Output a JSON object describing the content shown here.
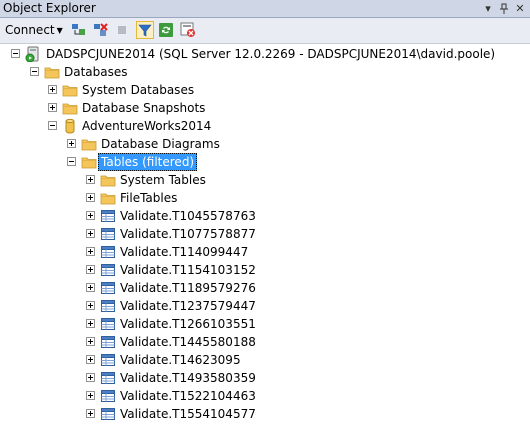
{
  "panel": {
    "title": "Object Explorer"
  },
  "toolbar": {
    "connect_label": "Connect"
  },
  "tree": {
    "server": {
      "label": "DADSPCJUNE2014 (SQL Server 12.0.2269 - DADSPCJUNE2014\\david.poole)"
    },
    "databases": {
      "label": "Databases"
    },
    "system_databases": {
      "label": "System Databases"
    },
    "database_snapshots": {
      "label": "Database Snapshots"
    },
    "adventureworks": {
      "label": "AdventureWorks2014"
    },
    "database_diagrams": {
      "label": "Database Diagrams"
    },
    "tables": {
      "label": "Tables (filtered)"
    },
    "system_tables": {
      "label": "System Tables"
    },
    "filetables": {
      "label": "FileTables"
    },
    "table_items": [
      "Validate.T1045578763",
      "Validate.T1077578877",
      "Validate.T114099447",
      "Validate.T1154103152",
      "Validate.T1189579276",
      "Validate.T1237579447",
      "Validate.T1266103551",
      "Validate.T1445580188",
      "Validate.T14623095",
      "Validate.T1493580359",
      "Validate.T1522104463",
      "Validate.T1554104577"
    ]
  },
  "colors": {
    "selection": "#3399ff",
    "folder": "#f3c55a",
    "title_bar": "#cfd6e5",
    "toolbar": "#e9ecf2"
  }
}
